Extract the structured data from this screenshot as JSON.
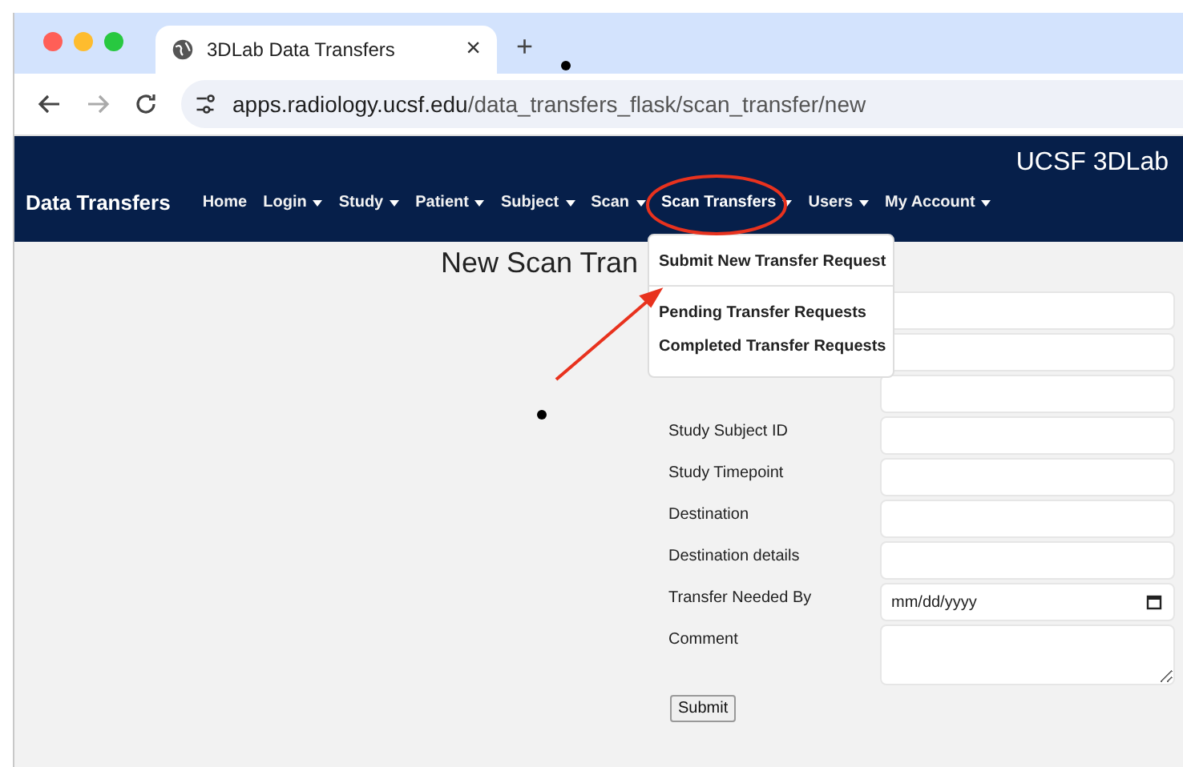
{
  "browser": {
    "tab_title": "3DLab Data Transfers",
    "new_tab": "+",
    "close": "×",
    "url_host": "apps.radiology.ucsf.edu",
    "url_path": "/data_transfers_flask/scan_transfer/new"
  },
  "header": {
    "org": "UCSF 3DLab",
    "brand": "Data Transfers",
    "nav": [
      {
        "label": "Home",
        "dropdown": false,
        "expanded": false
      },
      {
        "label": "Login",
        "dropdown": true,
        "expanded": false
      },
      {
        "label": "Study",
        "dropdown": true,
        "expanded": false
      },
      {
        "label": "Patient",
        "dropdown": true,
        "expanded": false
      },
      {
        "label": "Subject",
        "dropdown": true,
        "expanded": false
      },
      {
        "label": "Scan",
        "dropdown": true,
        "expanded": false
      },
      {
        "label": "Scan Transfers",
        "dropdown": true,
        "expanded": true
      },
      {
        "label": "Users",
        "dropdown": true,
        "expanded": false
      },
      {
        "label": "My Account",
        "dropdown": true,
        "expanded": false
      }
    ]
  },
  "menu": {
    "items": [
      {
        "kind": "item",
        "label": "Submit New Transfer Request"
      },
      {
        "kind": "divider"
      },
      {
        "kind": "item",
        "label": "Pending Transfer Requests"
      },
      {
        "kind": "item",
        "label": "Completed Transfer Requests"
      }
    ]
  },
  "page": {
    "title": "New Scan Tran",
    "fields": [
      {
        "kind": "text"
      },
      {
        "kind": "text"
      },
      {
        "kind": "text"
      },
      {
        "kind": "text",
        "label": "Study Subject ID"
      },
      {
        "kind": "text",
        "label": "Study Timepoint"
      },
      {
        "kind": "text",
        "label": "Destination"
      },
      {
        "kind": "text",
        "label": "Destination details"
      },
      {
        "kind": "date",
        "label": "Transfer Needed By",
        "placeholder": "mm/dd/yyyy"
      },
      {
        "kind": "textarea",
        "label": "Comment"
      }
    ],
    "submit": "Submit"
  }
}
